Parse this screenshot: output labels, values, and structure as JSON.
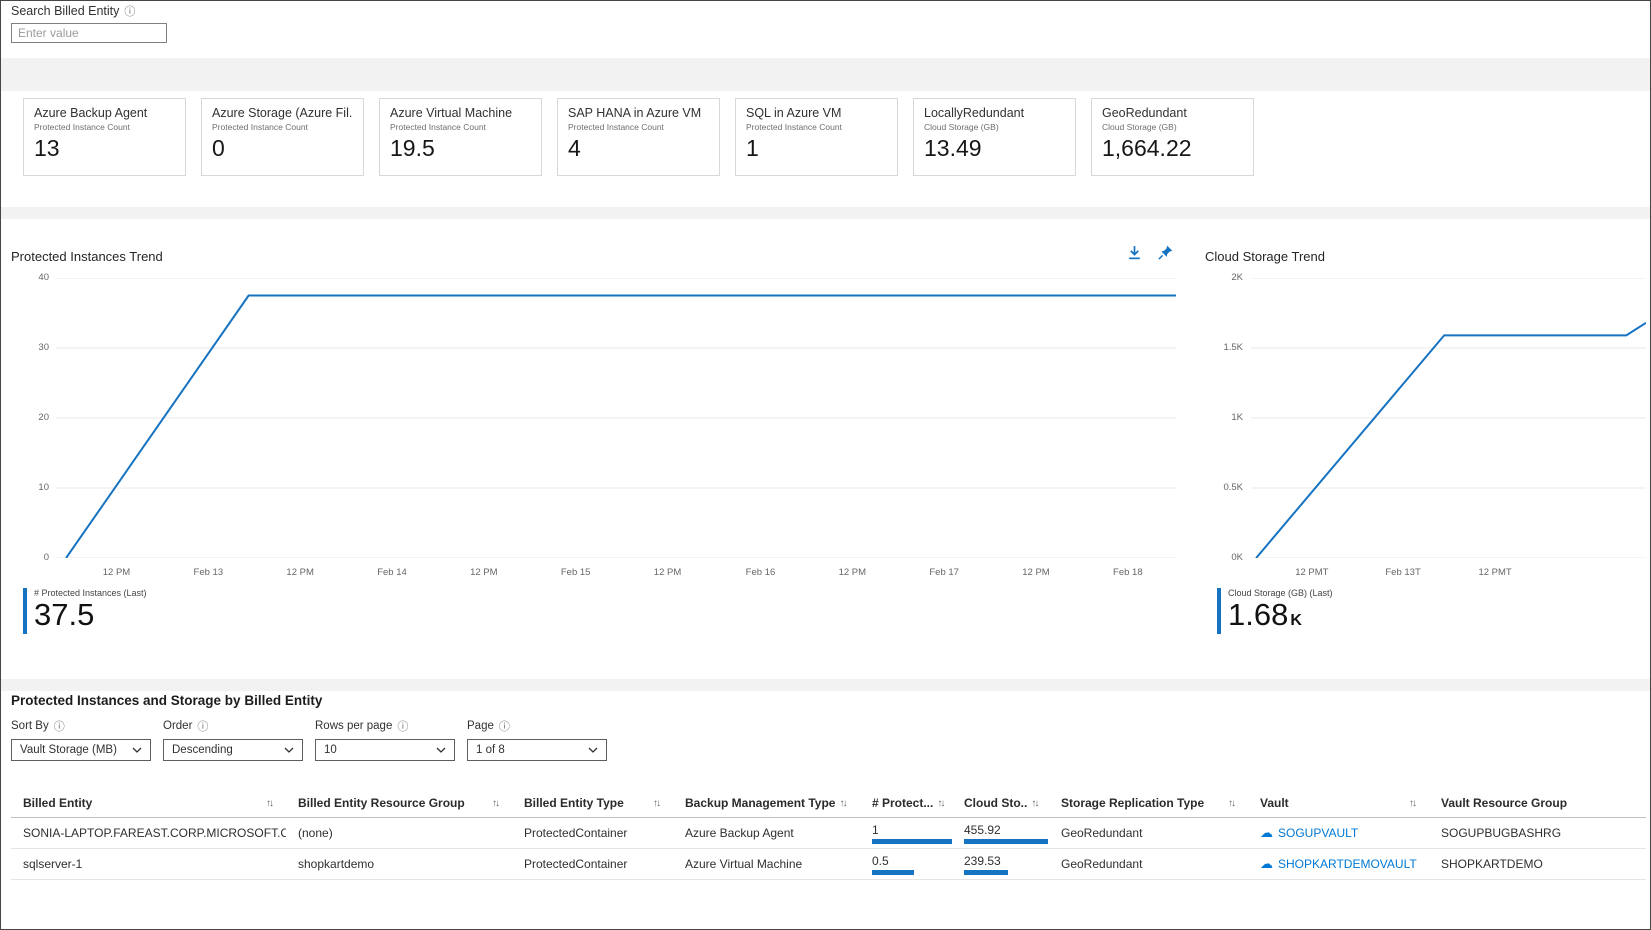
{
  "colors": {
    "accent": "#1673c2",
    "link": "#0078d4",
    "grid": "#e8e8e8"
  },
  "search": {
    "label": "Search Billed Entity",
    "placeholder": "Enter value"
  },
  "cards": [
    {
      "title": "Azure Backup Agent",
      "subtitle": "Protected Instance Count",
      "value": "13"
    },
    {
      "title": "Azure Storage (Azure Fil...",
      "subtitle": "Protected Instance Count",
      "value": "0"
    },
    {
      "title": "Azure Virtual Machine",
      "subtitle": "Protected Instance Count",
      "value": "19.5"
    },
    {
      "title": "SAP HANA in Azure VM",
      "subtitle": "Protected Instance Count",
      "value": "4"
    },
    {
      "title": "SQL in Azure VM",
      "subtitle": "Protected Instance Count",
      "value": "1"
    },
    {
      "title": "LocallyRedundant",
      "subtitle": "Cloud Storage (GB)",
      "value": "13.49"
    },
    {
      "title": "GeoRedundant",
      "subtitle": "Cloud Storage (GB)",
      "value": "1,664.22"
    }
  ],
  "chart_data": [
    {
      "type": "line",
      "title": "Protected Instances Trend",
      "ylim": [
        0,
        40
      ],
      "y_ticks": [
        "40",
        "30",
        "20",
        "10",
        "0"
      ],
      "x_ticks": [
        "12 PM",
        "Feb 13",
        "12 PM",
        "Feb 14",
        "12 PM",
        "Feb 15",
        "12 PM",
        "Feb 16",
        "12 PM",
        "Feb 17",
        "12 PM",
        "Feb 18"
      ],
      "grid": "horizontal",
      "series": [
        {
          "name": "# Protected Instances",
          "x": [
            0.009,
            0.172,
            1.0
          ],
          "y": [
            0,
            37.5,
            37.5
          ]
        }
      ],
      "legend": {
        "label": "# Protected Instances (Last)",
        "value": "37.5"
      }
    },
    {
      "type": "line",
      "title": "Cloud Storage Trend",
      "ylim": [
        0,
        2000
      ],
      "y_ticks": [
        "2K",
        "1.5K",
        "1K",
        "0.5K",
        "0K"
      ],
      "x_ticks": [
        "12 PMT",
        "Feb 13T",
        "12 PMT"
      ],
      "grid": "horizontal",
      "series": [
        {
          "name": "Cloud Storage (GB)",
          "x": [
            0.013,
            0.489,
            0.95,
            1.0
          ],
          "y": [
            0,
            1590,
            1590,
            1680
          ]
        }
      ],
      "legend": {
        "label": "Cloud Storage (GB) (Last)",
        "value": "1.68",
        "unit": "K"
      }
    }
  ],
  "table_section": {
    "title": "Protected Instances and Storage by Billed Entity",
    "controls": [
      {
        "label": "Sort By",
        "value": "Vault Storage (MB)"
      },
      {
        "label": "Order",
        "value": "Descending"
      },
      {
        "label": "Rows per page",
        "value": "10"
      },
      {
        "label": "Page",
        "value": "1 of 8"
      }
    ],
    "columns": [
      "Billed Entity",
      "Billed Entity Resource Group",
      "Billed Entity Type",
      "Backup Management Type",
      "# Protect...",
      "Cloud Sto..",
      "Storage Replication Type",
      "Vault",
      "Vault Resource Group"
    ],
    "rows": [
      {
        "billed_entity": "SONIA-LAPTOP.FAREAST.CORP.MICROSOFT.COM",
        "resource_group": "(none)",
        "entity_type": "ProtectedContainer",
        "mgmt_type": "Azure Backup Agent",
        "protected_count": "1",
        "protected_bar": 1.0,
        "cloud_storage": "455.92",
        "cloud_bar": 1.0,
        "replication": "GeoRedundant",
        "vault": "SOGUPVAULT",
        "vault_rg": "SOGUPBUGBASHRG"
      },
      {
        "billed_entity": "sqlserver-1",
        "resource_group": "shopkartdemo",
        "entity_type": "ProtectedContainer",
        "mgmt_type": "Azure Virtual Machine",
        "protected_count": "0.5",
        "protected_bar": 0.5,
        "cloud_storage": "239.53",
        "cloud_bar": 0.525,
        "replication": "GeoRedundant",
        "vault": "SHOPKARTDEMOVAULT",
        "vault_rg": "SHOPKARTDEMO"
      }
    ]
  }
}
